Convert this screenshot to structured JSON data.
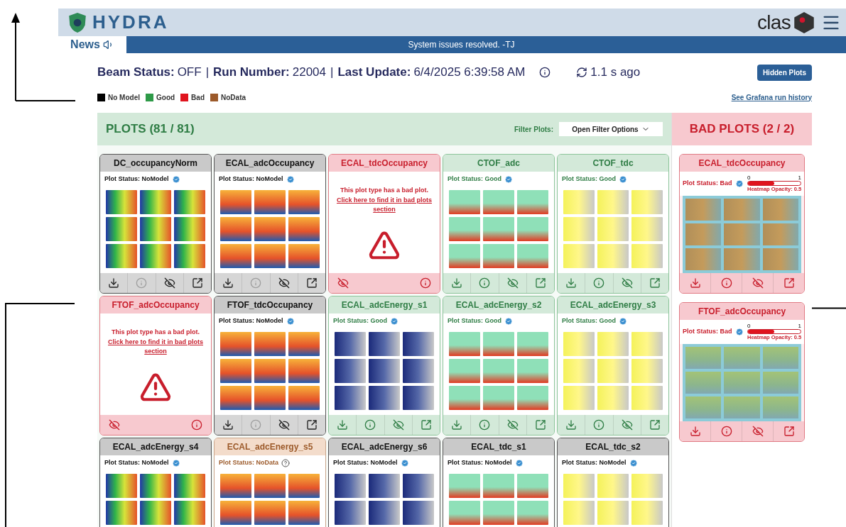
{
  "header": {
    "logo_text": "HYDRA",
    "brand_text": "clas"
  },
  "news": {
    "tab": "News",
    "message": "System issues resolved. -TJ"
  },
  "status_line": {
    "parts": [
      {
        "label": "Beam Status:",
        "value": "OFF"
      },
      {
        "separator": "|",
        "label": "Run Number:",
        "value": "22004"
      },
      {
        "separator": "|",
        "label": "Last Update:",
        "value": "6/4/2025 6:39:58 AM"
      }
    ],
    "refresh": "1.1 s ago",
    "hidden_button": "Hidden Plots"
  },
  "legend": [
    {
      "label": "No Model",
      "color": "#000000"
    },
    {
      "label": "Good",
      "color": "#2e9a48"
    },
    {
      "label": "Bad",
      "color": "#e0141e"
    },
    {
      "label": "NoData",
      "color": "#9c5a2a"
    }
  ],
  "grafana_link": "See Grafana run history",
  "plots": {
    "title": "PLOTS (81 / 81)",
    "filter_label": "Filter Plots:",
    "filter_button": "Open Filter Options",
    "cards": [
      {
        "kind": "nomodel",
        "title": "DC_occupancyNorm",
        "status": "Plot Status: NoModel",
        "info_disabled": true
      },
      {
        "kind": "nomodel",
        "title": "ECAL_adcOccupancy",
        "status": "Plot Status: NoModel",
        "info_disabled": true
      },
      {
        "kind": "bad-link",
        "title": "ECAL_tdcOccupancy",
        "message": "This plot type has a bad plot.",
        "link": "Click here to find it in bad plots section"
      },
      {
        "kind": "good",
        "title": "CTOF_adc",
        "status": "Plot Status: Good",
        "info_disabled": false
      },
      {
        "kind": "good",
        "title": "CTOF_tdc",
        "status": "Plot Status: Good",
        "info_disabled": false
      },
      {
        "kind": "bad-link",
        "title": "FTOF_adcOccupancy",
        "message": "This plot type has a bad plot.",
        "link": "Click here to find it in bad plots section"
      },
      {
        "kind": "nomodel",
        "title": "FTOF_tdcOccupancy",
        "status": "Plot Status: NoModel",
        "info_disabled": true
      },
      {
        "kind": "good",
        "title": "ECAL_adcEnergy_s1",
        "status": "Plot Status: Good",
        "info_disabled": false
      },
      {
        "kind": "good",
        "title": "ECAL_adcEnergy_s2",
        "status": "Plot Status: Good",
        "info_disabled": false
      },
      {
        "kind": "good",
        "title": "ECAL_adcEnergy_s3",
        "status": "Plot Status: Good",
        "info_disabled": false
      },
      {
        "kind": "nomodel",
        "title": "ECAL_adcEnergy_s4",
        "status": "Plot Status: NoModel"
      },
      {
        "kind": "nodata",
        "title": "ECAL_adcEnergy_s5",
        "status": "Plot Status: NoData"
      },
      {
        "kind": "nomodel",
        "title": "ECAL_adcEnergy_s6",
        "status": "Plot Status: NoModel"
      },
      {
        "kind": "nomodel",
        "title": "ECAL_tdc_s1",
        "status": "Plot Status: NoModel"
      },
      {
        "kind": "nomodel",
        "title": "ECAL_tdc_s2",
        "status": "Plot Status: NoModel"
      }
    ]
  },
  "bad_plots": {
    "title": "BAD PLOTS (2 / 2)",
    "cards": [
      {
        "title": "ECAL_tdcOccupancy",
        "status": "Plot Status: Bad",
        "opacity": {
          "min": "0",
          "max": "1",
          "label": "Heatmap Opacity: 0.5",
          "level": 0.5
        }
      },
      {
        "title": "FTOF_adcOccupancy",
        "status": "Plot Status: Bad",
        "opacity": {
          "min": "0",
          "max": "1",
          "label": "Heatmap Opacity: 0.5",
          "level": 0.5
        }
      }
    ]
  }
}
